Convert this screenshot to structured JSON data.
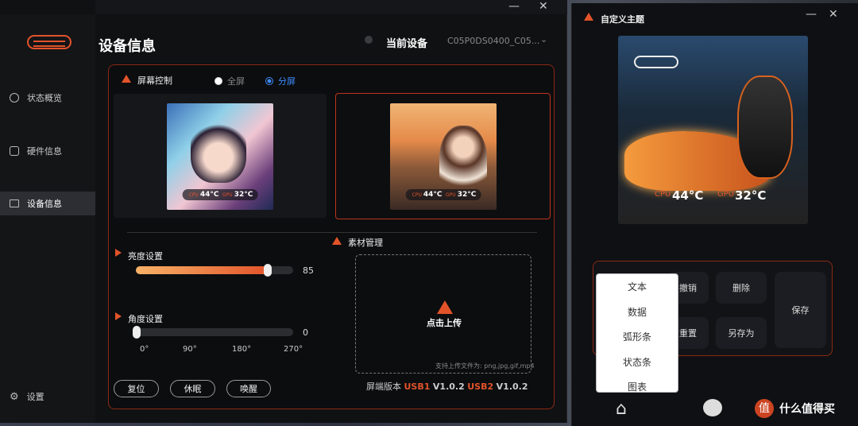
{
  "sidebar": {
    "items": [
      {
        "label": "状态概览",
        "icon": "gauge-icon"
      },
      {
        "label": "硬件信息",
        "icon": "copy-icon"
      },
      {
        "label": "设备信息",
        "icon": "monitor-icon",
        "active": true
      }
    ],
    "settings_label": "设置"
  },
  "header": {
    "page_title": "设备信息",
    "current_device_label": "当前设备",
    "device_id": "C05P0DS0400_C05..."
  },
  "screen_control": {
    "title": "屏幕控制",
    "modes": [
      {
        "label": "全屏",
        "selected": false
      },
      {
        "label": "分屏",
        "selected": true
      }
    ],
    "left_screen": {
      "cpu_label": "CPU",
      "cpu_temp": "44°C",
      "gpu_label": "GPU",
      "gpu_temp": "32°C"
    },
    "right_screen": {
      "cpu_label": "CPU",
      "cpu_temp": "44°C",
      "gpu_label": "GPU",
      "gpu_temp": "32°C"
    }
  },
  "brightness": {
    "label": "亮度设置",
    "value": "85",
    "level_fraction": 0.85
  },
  "angle": {
    "label": "角度设置",
    "value": "0",
    "ticks": [
      "0°",
      "90°",
      "180°",
      "270°"
    ]
  },
  "buttons": {
    "reset": "复位",
    "sleep": "休眠",
    "wake": "唤醒"
  },
  "material": {
    "title": "素材管理",
    "upload_label": "点击上传",
    "formats": "支持上传文件为: png,jpg,gif,mp4"
  },
  "version": {
    "prefix": "屏端版本",
    "usb1_label": "USB1",
    "usb1_version": "V1.0.2",
    "usb2_label": "USB2",
    "usb2_version": "V1.0.2"
  },
  "theme_window": {
    "title": "自定义主题",
    "preview": {
      "cpu_label": "CPU",
      "cpu_temp": "44°C",
      "gpu_label": "GPU",
      "gpu_temp": "32°C"
    },
    "tools": {
      "undo": "撤销",
      "delete": "删除",
      "reset": "重置",
      "save_as": "另存为",
      "save": "保存"
    },
    "menu_items": [
      "文本",
      "数据",
      "弧形条",
      "状态条",
      "图表"
    ]
  },
  "taskbar": {
    "watermark": "什么值得买"
  },
  "colors": {
    "accent": "#e2532a",
    "radio_on": "#3d8cff",
    "panel_border": "#8a2a14"
  }
}
